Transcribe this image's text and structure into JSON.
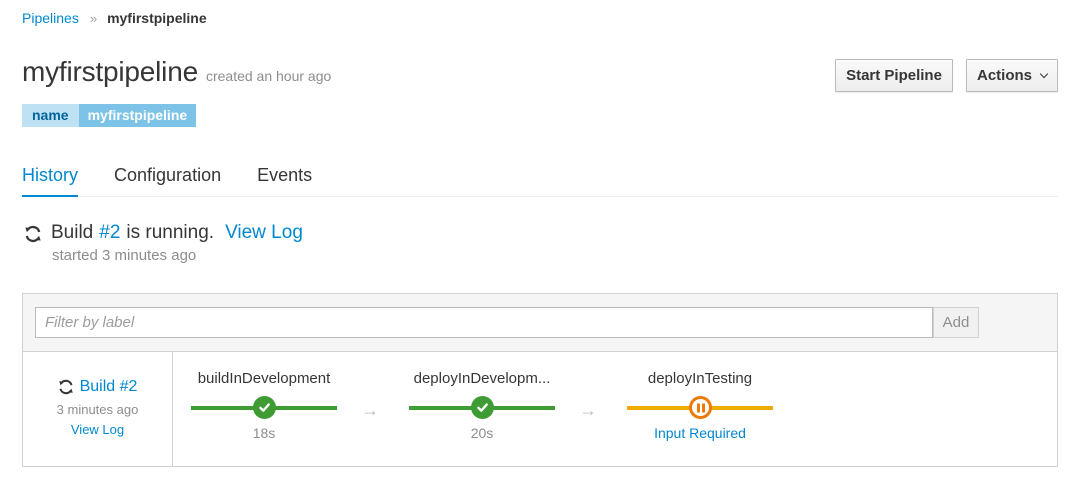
{
  "breadcrumb": {
    "parent": "Pipelines",
    "separator": "»",
    "current": "myfirstpipeline"
  },
  "header": {
    "title": "myfirstpipeline",
    "created": "created an hour ago"
  },
  "label": {
    "key": "name",
    "value": "myfirstpipeline"
  },
  "actions": {
    "start_label": "Start Pipeline",
    "actions_label": "Actions"
  },
  "tabs": [
    {
      "label": "History",
      "active": true
    },
    {
      "label": "Configuration",
      "active": false
    },
    {
      "label": "Events",
      "active": false
    }
  ],
  "status": {
    "prefix": "Build",
    "build_number": "#2",
    "suffix": "is running.",
    "view_log": "View Log",
    "started": "started 3 minutes ago"
  },
  "filter": {
    "placeholder": "Filter by label",
    "add_label": "Add"
  },
  "build": {
    "label": "Build #2",
    "time": "3 minutes ago",
    "view_log": "View Log"
  },
  "stages": [
    {
      "name": "buildInDevelopment",
      "detail": "18s",
      "state": "complete",
      "icon": "check-icon"
    },
    {
      "name": "deployInDevelopm...",
      "detail": "20s",
      "state": "complete",
      "icon": "check-icon"
    },
    {
      "name": "deployInTesting",
      "detail": "Input Required",
      "state": "paused",
      "icon": "pause-icon"
    }
  ],
  "stage_arrow": "→",
  "colors": {
    "accent": "#0088ce",
    "complete": "#3f9c35",
    "paused": "#ec7a08",
    "paused_bar": "#f0ab00",
    "label_key_bg": "#bee1f4",
    "label_value_bg": "#7dc3e8"
  }
}
